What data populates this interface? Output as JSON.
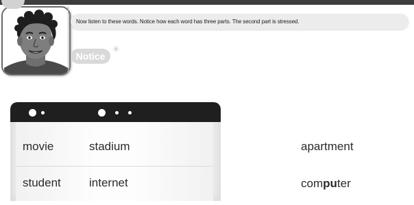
{
  "speaker": {
    "instruction": "Now listen to these words. Notice how each word has three parts. The second part is stressed.",
    "notice_label": "Notice",
    "sparkle_icon": "sparkle-icon",
    "avatar_icon": "man-face-avatar"
  },
  "word_card": {
    "rows": [
      [
        "movie",
        "stadium"
      ],
      [
        "student",
        "internet"
      ]
    ]
  },
  "outside_words": {
    "apartment": "apartment",
    "computer_prefix": "com",
    "computer_stressed": "pu",
    "computer_suffix": "ter"
  },
  "colors": {
    "header": "#1f1f1f",
    "bubble": "#ececec",
    "notice_pill": "#d9d9d9",
    "top_rule": "#3d3d3d"
  }
}
